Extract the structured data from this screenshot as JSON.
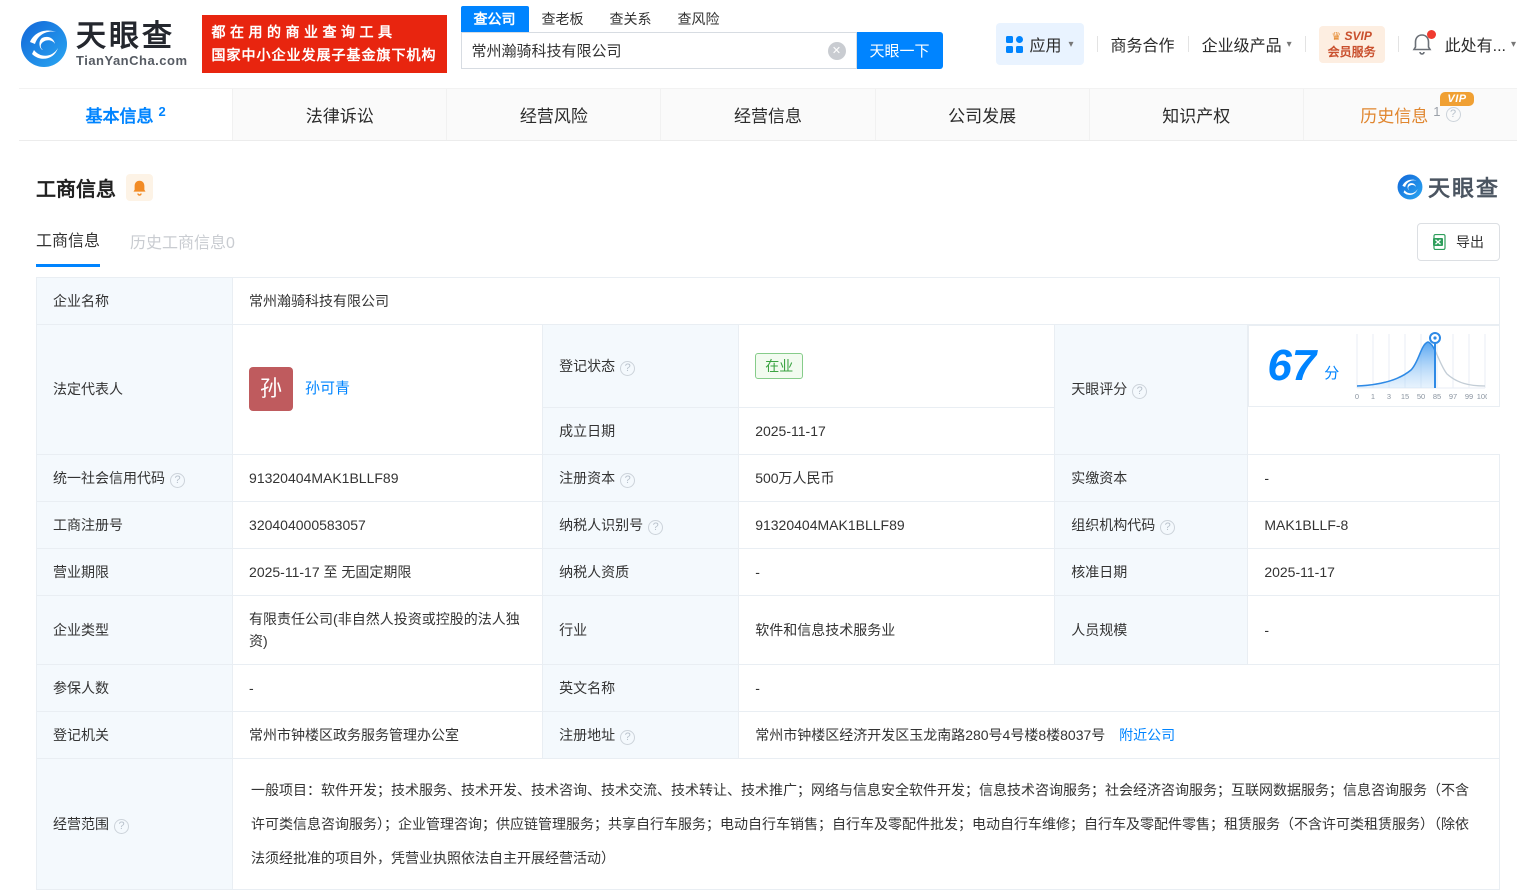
{
  "colors": {
    "primary": "#0084ff",
    "banner_red": "#e8250f",
    "vip_orange": "#f0a033",
    "status_green": "#3ba342",
    "score_blue": "#2e8ae6"
  },
  "icons": {
    "help": "?",
    "caret": "▾",
    "clear": "✕",
    "crown": "♛"
  },
  "brand": {
    "name": "天眼查",
    "domain": "TianYanCha.com",
    "slogan_line1": "都在用的商业查询工具",
    "slogan_line2": "国家中小企业发展子基金旗下机构"
  },
  "search": {
    "tabs": [
      {
        "label": "查公司"
      },
      {
        "label": "查老板"
      },
      {
        "label": "查关系"
      },
      {
        "label": "查风险"
      }
    ],
    "value": "常州瀚骑科技有限公司",
    "button": "天眼一下"
  },
  "header_right": {
    "apps": "应用",
    "business_coop": "商务合作",
    "enterprise_products": "企业级产品",
    "svip_line1": "SVIP",
    "svip_line2": "会员服务",
    "more": "此处有..."
  },
  "nav": {
    "tabs": [
      {
        "label": "基本信息",
        "count": "2"
      },
      {
        "label": "法律诉讼"
      },
      {
        "label": "经营风险"
      },
      {
        "label": "经营信息"
      },
      {
        "label": "公司发展"
      },
      {
        "label": "知识产权"
      },
      {
        "label": "历史信息",
        "count": "1"
      }
    ],
    "vip_badge": "VIP"
  },
  "section": {
    "title": "工商信息",
    "subtabs": [
      {
        "label": "工商信息"
      },
      {
        "label": "历史工商信息0"
      }
    ],
    "export_label": "导出",
    "watermark": "天眼查"
  },
  "score_chart": {
    "type": "area",
    "score": 67,
    "x_labels": [
      "0",
      "1",
      "3",
      "15",
      "50",
      "85",
      "97",
      "99",
      "100"
    ]
  },
  "fields": {
    "company_name": {
      "label": "企业名称",
      "value": "常州瀚骑科技有限公司"
    },
    "legal_rep": {
      "label": "法定代表人",
      "avatar": "孙",
      "value": "孙可青"
    },
    "reg_status": {
      "label": "登记状态",
      "value": "在业"
    },
    "establish_date": {
      "label": "成立日期",
      "value": "2025-11-17"
    },
    "score": {
      "label": "天眼评分",
      "value": "67",
      "unit": "分"
    },
    "credit_code": {
      "label": "统一社会信用代码",
      "value": "91320404MAK1BLLF89"
    },
    "reg_capital": {
      "label": "注册资本",
      "value": "500万人民币"
    },
    "paid_capital": {
      "label": "实缴资本",
      "value": "-"
    },
    "reg_number": {
      "label": "工商注册号",
      "value": "320404000583057"
    },
    "taxpayer_id": {
      "label": "纳税人识别号",
      "value": "91320404MAK1BLLF89"
    },
    "org_code": {
      "label": "组织机构代码",
      "value": "MAK1BLLF-8"
    },
    "business_term": {
      "label": "营业期限",
      "value": "2025-11-17 至 无固定期限"
    },
    "taxpayer_quality": {
      "label": "纳税人资质",
      "value": "-"
    },
    "approval_date": {
      "label": "核准日期",
      "value": "2025-11-17"
    },
    "company_type": {
      "label": "企业类型",
      "value": "有限责任公司(非自然人投资或控股的法人独资)"
    },
    "industry": {
      "label": "行业",
      "value": "软件和信息技术服务业"
    },
    "staff_size": {
      "label": "人员规模",
      "value": "-"
    },
    "insured_count": {
      "label": "参保人数",
      "value": "-"
    },
    "english_name": {
      "label": "英文名称",
      "value": "-"
    },
    "reg_authority": {
      "label": "登记机关",
      "value": "常州市钟楼区政务服务管理办公室"
    },
    "reg_address": {
      "label": "注册地址",
      "value": "常州市钟楼区经济开发区玉龙南路280号4号楼8楼8037号",
      "nearby_link": "附近公司"
    },
    "business_scope": {
      "label": "经营范围",
      "value": "一般项目：软件开发；技术服务、技术开发、技术咨询、技术交流、技术转让、技术推广；网络与信息安全软件开发；信息技术咨询服务；社会经济咨询服务；互联网数据服务；信息咨询服务（不含许可类信息咨询服务）；企业管理咨询；供应链管理服务；共享自行车服务；电动自行车销售；自行车及零配件批发；电动自行车维修；自行车及零配件零售；租赁服务（不含许可类租赁服务）（除依法须经批准的项目外，凭营业执照依法自主开展经营活动）"
    }
  }
}
